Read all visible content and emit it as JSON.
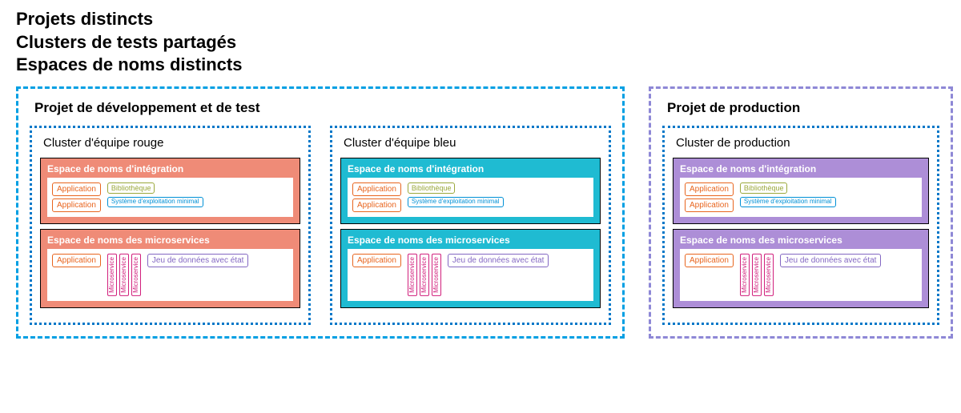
{
  "titles": [
    "Projets distincts",
    "Clusters de tests partagés",
    "Espaces de noms distincts"
  ],
  "projects": {
    "dev": {
      "title": "Projet de développement et de test",
      "clusters": [
        {
          "title": "Cluster d'équipe rouge",
          "nsColor": "ns-red"
        },
        {
          "title": "Cluster d'équipe bleu",
          "nsColor": "ns-teal"
        }
      ]
    },
    "prod": {
      "title": "Projet de production",
      "clusters": [
        {
          "title": "Cluster de production",
          "nsColor": "ns-purple"
        }
      ]
    }
  },
  "ns": {
    "integration": "Espace de noms d'intégration",
    "microservices": "Espace de noms des microservices"
  },
  "labels": {
    "application": "Application",
    "library": "Bibliothèque",
    "os": "Système d'exploitation minimal",
    "microservice": "Microservice",
    "dataset": "Jeu de données avec état"
  },
  "colors": {
    "devBorder": "#009fe3",
    "prodBorder": "#8e88d6",
    "red": "#ef8b77",
    "teal": "#1fbbd2",
    "purple": "#ad8ed7"
  }
}
